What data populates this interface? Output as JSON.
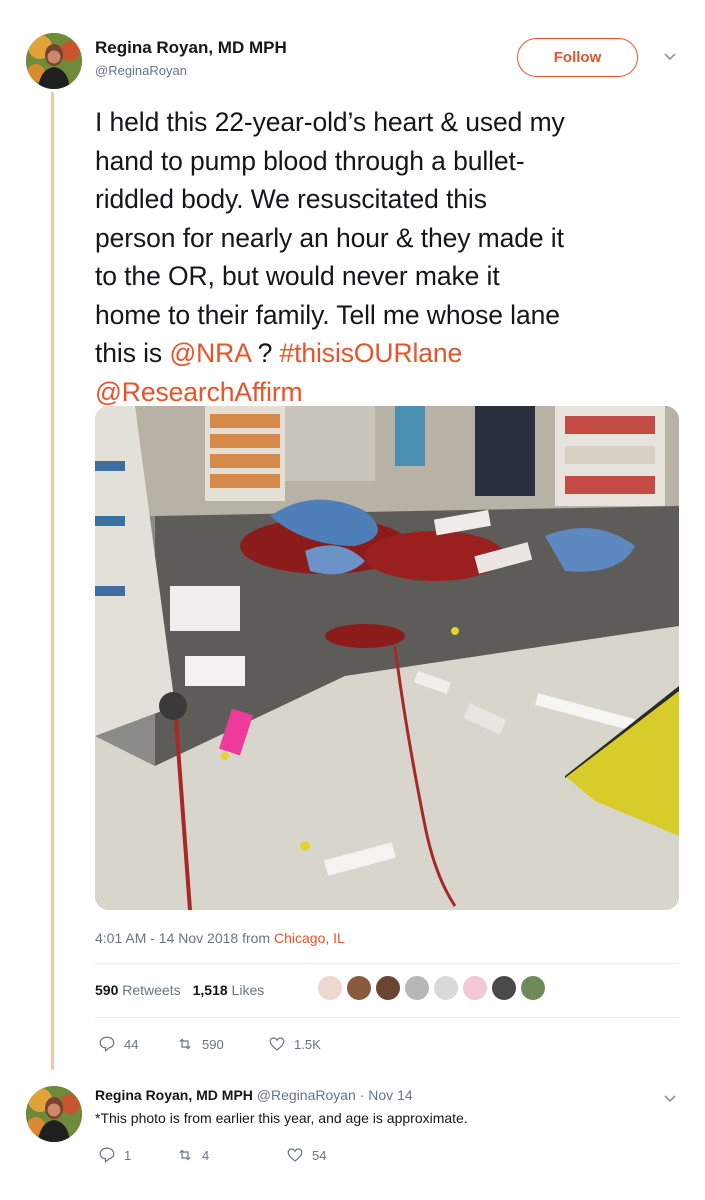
{
  "tweet": {
    "display_name": "Regina Royan, MD MPH",
    "handle": "@ReginaRoyan",
    "follow_label": "Follow",
    "text_lines": [
      "I held this 22-year-old’s heart & used my",
      "hand to pump blood through a bullet-",
      "riddled body.  We resuscitated this",
      "person for nearly an hour & they made it",
      "to the OR, but would never make it",
      "home to their family. Tell me whose lane"
    ],
    "line7_prefix": "this is ",
    "mention_nra": "@NRA",
    "line7_mid": " ? ",
    "hashtag": "#thisisOURlane",
    "mention_research": "@ResearchAffirm",
    "timestamp": "4:01 AM - 14 Nov 2018 from ",
    "location": "Chicago, IL",
    "retweets_count": "590",
    "retweets_label": "Retweets",
    "likes_count": "1,518",
    "likes_label": "Likes",
    "reply_count": "44",
    "retweet_action_count": "590",
    "like_action_count": "1.5K"
  },
  "reply": {
    "display_name": "Regina Royan, MD MPH",
    "meta": "@ReginaRoyan · Nov 14",
    "text": "*This photo is from earlier this year, and age is approximate.",
    "reply_count": "1",
    "retweet_count": "4",
    "like_count": "54"
  },
  "colors": {
    "accent": "#e8542a",
    "secondary_text": "#657786",
    "thread_line": "#f4c3a8"
  },
  "icons": {
    "caret": "chevron-down-icon",
    "reply": "reply-icon",
    "retweet": "retweet-icon",
    "like": "heart-icon"
  }
}
